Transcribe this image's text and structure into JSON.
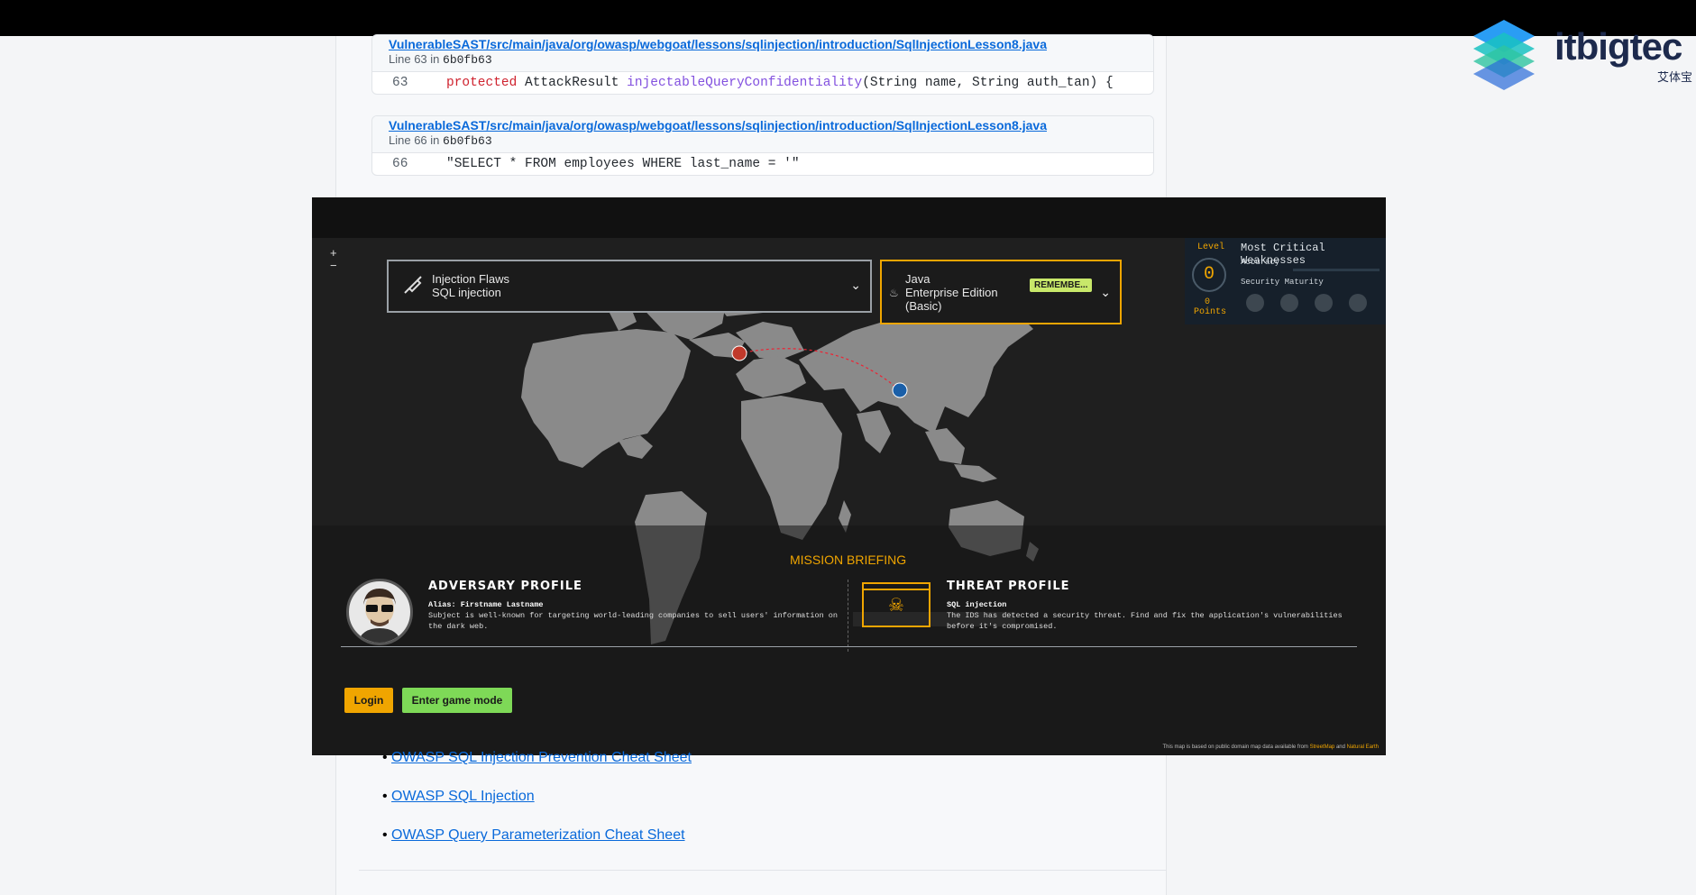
{
  "code_results": [
    {
      "path": "VulnerableSAST/src/main/java/org/owasp/webgoat/lessons/sqlinjection/introduction/SqlInjectionLesson8.java",
      "line_prefix": "Line 63 in",
      "commit": "6b0fb63",
      "line_number": "63",
      "code_keyword": "protected",
      "code_type": "AttackResult",
      "code_fn": "injectableQueryConfidentiality",
      "code_rest": "(String name, String auth_tan) {"
    },
    {
      "path": "VulnerableSAST/src/main/java/org/owasp/webgoat/lessons/sqlinjection/introduction/SqlInjectionLesson8.java",
      "line_prefix": "Line 66 in",
      "commit": "6b0fb63",
      "line_number": "66",
      "code_text": "\"SELECT * FROM employees WHERE last_name = '\""
    }
  ],
  "logo": {
    "text": "itbigtec",
    "sub": "艾体宝"
  },
  "game": {
    "zoom_in": "+",
    "zoom_out": "−",
    "category_line1": "Injection Flaws",
    "category_line2": "SQL injection",
    "stack_line1": "Java",
    "stack_line2": "Enterprise Edition",
    "stack_line3": "(Basic)",
    "stack_badge": "REMEMBE...",
    "stats": {
      "level_label": "Level",
      "level_value": "0",
      "points_value": "0",
      "points_label": "Points",
      "weakness_title": "Most Critical Weaknesses",
      "accuracy_label": "Accuracy",
      "maturity_label": "Security Maturity"
    },
    "mission_title": "MISSION BRIEFING",
    "adversary_title": "ADVERSARY PROFILE",
    "adversary_alias": "Alias: Firstname Lastname",
    "adversary_desc": "Subject is well-known for targeting world-leading companies to sell users' information on the dark web.",
    "threat_title": "THREAT PROFILE",
    "threat_name": "SQL injection",
    "threat_desc": "The IDS has detected a security threat. Find and fix the application's vulnerabilities before it's compromised.",
    "login_label": "Login",
    "game_mode_label": "Enter game mode",
    "credit_text": "This map is based on public domain map data available from",
    "credit_link1": "StreetMap",
    "credit_and": "and",
    "credit_link2": "Natural Earth"
  },
  "links": [
    "OWASP SQL Injection Prevention Cheat Sheet",
    "OWASP SQL Injection",
    "OWASP Query Parameterization Cheat Sheet"
  ],
  "colors": {
    "accent": "#f0a500",
    "link": "#0969da",
    "game_bg": "#1f1f1f",
    "go_green": "#7ed957"
  }
}
